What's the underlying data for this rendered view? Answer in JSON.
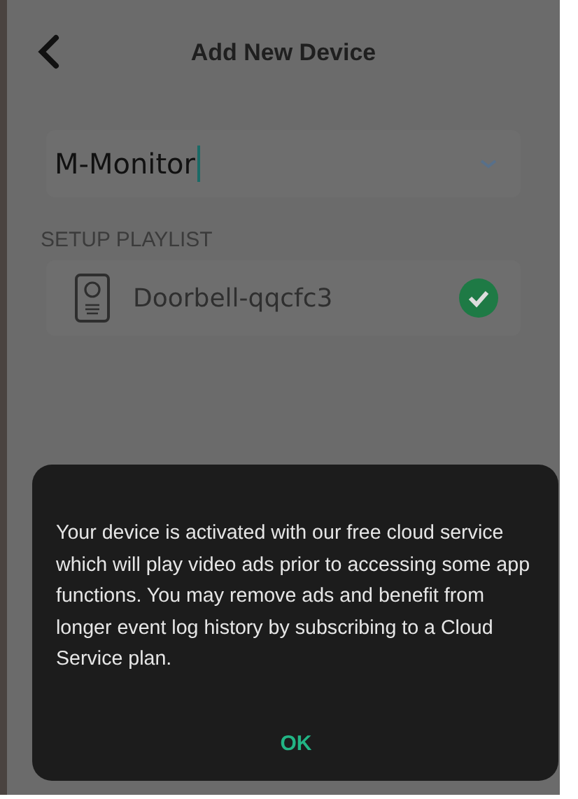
{
  "header": {
    "title": "Add New Device"
  },
  "device_name_field": {
    "value": "M-Monitor"
  },
  "playlist": {
    "label": "SETUP PLAYLIST",
    "items": [
      {
        "name": "Doorbell-qqcfc3",
        "checked": true
      }
    ]
  },
  "dialog": {
    "message": "Your device is activated with our free cloud service which will play video ads prior to accessing some app functions. You may remove ads and benefit from longer event log history by subscribing to a Cloud Service plan.",
    "button": "OK"
  }
}
